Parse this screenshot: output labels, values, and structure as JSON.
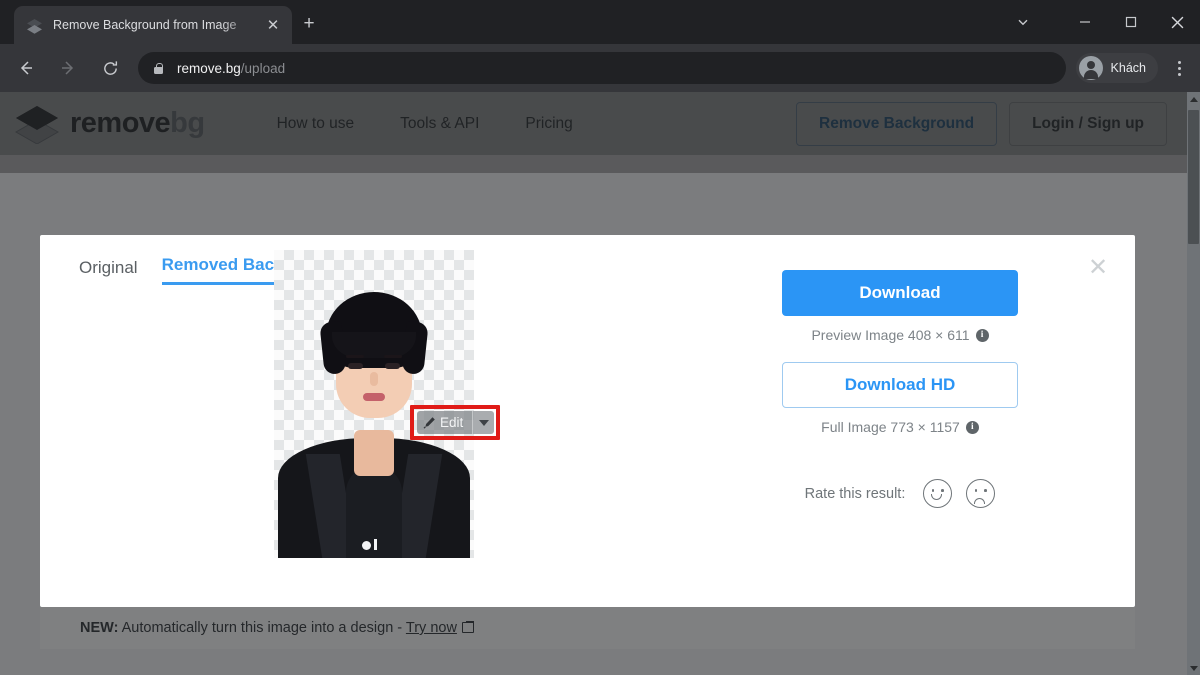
{
  "browser": {
    "tab": {
      "title": "Remove Background from Image",
      "favicon_icon": "layers-icon",
      "close_icon": "close-icon"
    },
    "new_tab_icon": "plus-icon",
    "window_controls": {
      "chevron_icon": "chevron-down-icon",
      "minimize_icon": "minimize-icon",
      "maximize_icon": "maximize-icon",
      "close_icon": "close-icon"
    },
    "toolbar": {
      "back_icon": "arrow-left-icon",
      "forward_icon": "arrow-right-icon",
      "reload_icon": "reload-icon",
      "lock_icon": "lock-icon",
      "url_host": "remove.bg",
      "url_path": "/upload",
      "profile_name": "Khách",
      "profile_icon": "account-circle-icon",
      "menu_icon": "kebab-menu-icon"
    }
  },
  "site_header": {
    "logo_icon": "removebg-layers-logo",
    "brand_primary": "remove",
    "brand_secondary": "bg",
    "nav": [
      {
        "label": "How to use"
      },
      {
        "label": "Tools & API"
      },
      {
        "label": "Pricing"
      }
    ],
    "remove_background_button": "Remove Background",
    "login_button": "Login / Sign up"
  },
  "modal": {
    "tabs": [
      {
        "label": "Original",
        "active": false
      },
      {
        "label": "Removed Background",
        "active": true
      }
    ],
    "close_icon": "close-icon",
    "preview": {
      "background": "transparent-checkerboard",
      "subject": "portrait-photo-person-black-blazer"
    },
    "edit_button": {
      "label": "Edit",
      "brush_icon": "brush-icon",
      "dropdown_icon": "caret-down-icon",
      "highlight_color": "#e01b17"
    },
    "actions": {
      "download_label": "Download",
      "preview_caption": "Preview Image 408 × 611",
      "preview_info_icon": "info-icon",
      "download_hd_label": "Download HD",
      "full_caption": "Full Image 773 × 1157",
      "full_info_icon": "info-icon",
      "rate_label": "Rate this result:",
      "rate_happy_icon": "smiley-happy-icon",
      "rate_sad_icon": "smiley-sad-icon"
    }
  },
  "new_banner": {
    "badge": "NEW:",
    "text": "Automatically turn this image into a design -",
    "link": "Try now",
    "external_icon": "external-link-icon"
  },
  "scrollbar": {
    "up_icon": "scroll-up-arrow-icon",
    "down_icon": "scroll-down-arrow-icon"
  },
  "colors": {
    "accent_blue": "#2b95f5",
    "tab_active_blue": "#3a9bf0",
    "highlight_red": "#e01b17",
    "chrome_dark": "#202124"
  }
}
